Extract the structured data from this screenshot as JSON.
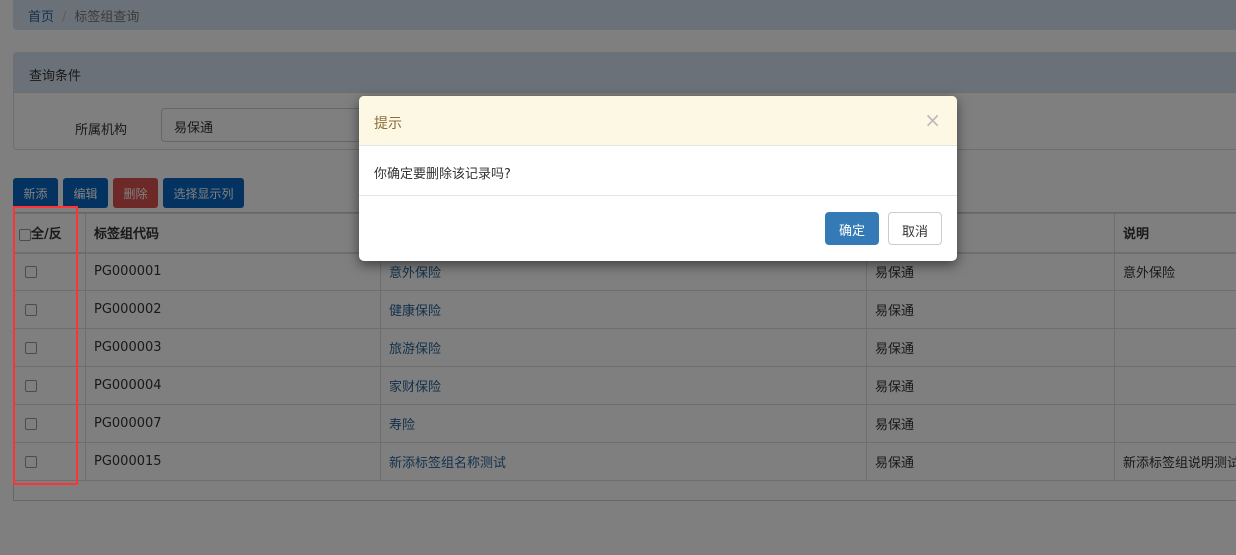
{
  "breadcrumb": {
    "home": "首页",
    "separator": "/",
    "current": "标签组查询"
  },
  "query": {
    "title": "查询条件",
    "org_label": "所属机构",
    "org_value": "易保通"
  },
  "toolbar": {
    "add": "新添",
    "edit": "编辑",
    "delete": "删除",
    "columns": "选择显示列"
  },
  "table": {
    "headers": [
      "全/反",
      "标签组代码",
      "",
      "",
      "说明"
    ],
    "rows": [
      {
        "code": "PG000001",
        "name": "意外保险",
        "org": "易保通",
        "desc": "意外保险"
      },
      {
        "code": "PG000002",
        "name": "健康保险",
        "org": "易保通",
        "desc": ""
      },
      {
        "code": "PG000003",
        "name": "旅游保险",
        "org": "易保通",
        "desc": ""
      },
      {
        "code": "PG000004",
        "name": "家财保险",
        "org": "易保通",
        "desc": ""
      },
      {
        "code": "PG000007",
        "name": "寿险",
        "org": "易保通",
        "desc": ""
      },
      {
        "code": "PG000015",
        "name": "新添标签组名称测试",
        "org": "易保通",
        "desc": "新添标签组说明测试"
      }
    ]
  },
  "modal": {
    "title": "提示",
    "close": "×",
    "message": "你确定要删除该记录吗?",
    "ok": "确定",
    "cancel": "取消"
  }
}
